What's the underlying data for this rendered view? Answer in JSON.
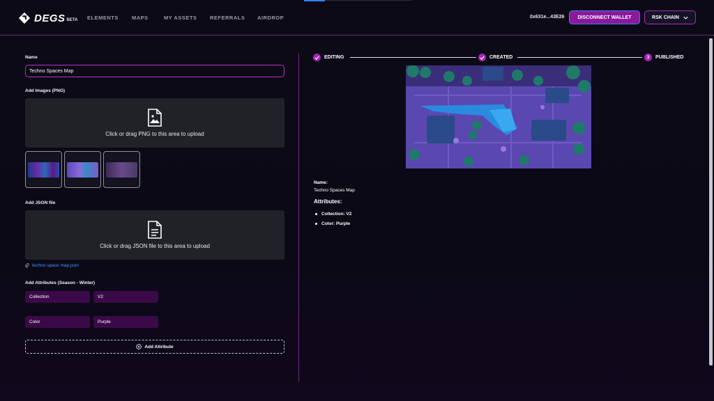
{
  "nav": {
    "brand": "DEGS",
    "brand_badge": "BETA",
    "links": [
      "ELEMENTS",
      "MAPS",
      "MY ASSETS",
      "REFERRALS",
      "AIRDROP"
    ],
    "wallet_address": "0x631e...43E26",
    "disconnect_label": "DISCONNECT WALLET",
    "chain_label": "RSK CHAIN"
  },
  "form": {
    "name_label": "Name",
    "name_value": "Techno Spaces Map",
    "images_label": "Add Images (PNG)",
    "images_dropzone": "Click or drag PNG to this area to upload",
    "json_label": "Add JSON file",
    "json_dropzone": "Click or drag JSON file to this area to upload",
    "json_filename": "techno space map.json",
    "attributes_label": "Add Attributes (Season - Winter)",
    "attributes": [
      {
        "key": "Collection",
        "value": "V2"
      },
      {
        "key": "Color",
        "value": "Purple"
      }
    ],
    "add_attribute_label": "Add Attribute"
  },
  "steps": [
    {
      "label": "EDITING",
      "state": "done"
    },
    {
      "label": "CREATED",
      "state": "done"
    },
    {
      "label": "PUBLISHED",
      "number": "3",
      "state": "current"
    }
  ],
  "preview": {
    "name_label": "Name:",
    "name_value": "Techno Spaces Map",
    "attributes_title": "Attributes:",
    "attributes": [
      "Collection: V2",
      "Color: Purple"
    ]
  },
  "colors": {
    "accent": "#a626b5",
    "link": "#4a90ff",
    "background": "#0c0a16"
  }
}
